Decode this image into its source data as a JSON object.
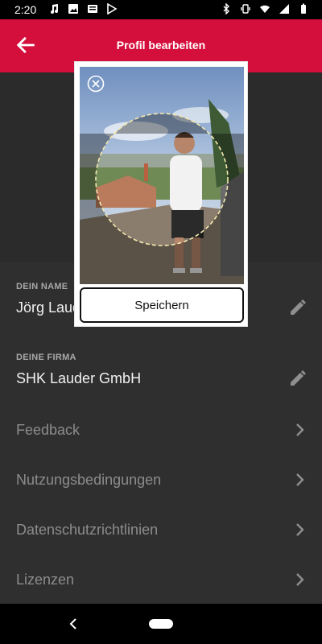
{
  "status_bar": {
    "time": "2:20",
    "icons_left": [
      "music-icon",
      "image-icon",
      "news-icon",
      "play-store-icon"
    ],
    "icons_right": [
      "bluetooth-icon",
      "vibrate-icon",
      "wifi-icon",
      "signal-icon",
      "battery-icon"
    ]
  },
  "appbar": {
    "title": "Profil bearbeiten",
    "color": "#d50f3b"
  },
  "fields": {
    "name_label": "DEIN NAME",
    "name_value": "Jörg Lauder",
    "company_label": "DEINE FIRMA",
    "company_value": "SHK Lauder GmbH"
  },
  "menu": [
    {
      "label": "Feedback"
    },
    {
      "label": "Nutzungsbedingungen"
    },
    {
      "label": "Datenschutzrichtlinien"
    },
    {
      "label": "Lizenzen"
    }
  ],
  "dialog": {
    "save_label": "Speichern"
  }
}
